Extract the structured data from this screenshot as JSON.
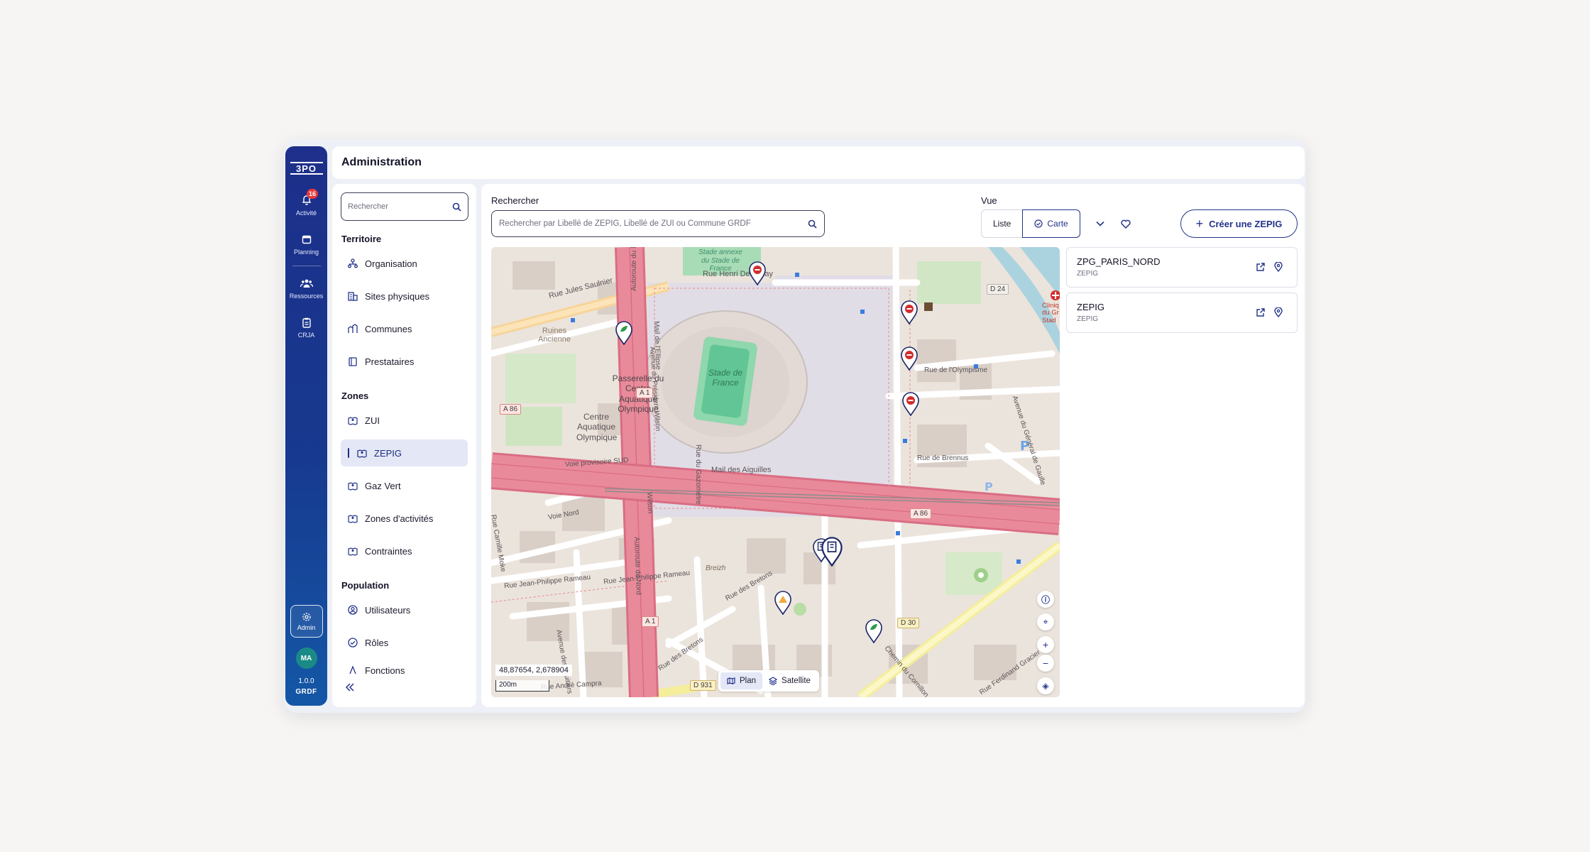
{
  "rail": {
    "logo": "3PO",
    "items": [
      {
        "label": "Activité",
        "icon": "bell-icon",
        "badge": "16"
      },
      {
        "label": "Planning",
        "icon": "calendar-icon"
      },
      {
        "label": "Ressources",
        "icon": "users-icon"
      },
      {
        "label": "CRJA",
        "icon": "clipboard-icon"
      }
    ],
    "admin_label": "Admin",
    "avatar_initials": "MA",
    "version": "1.0.0",
    "brand": "GRDF"
  },
  "header": {
    "title": "Administration"
  },
  "menu": {
    "search_placeholder": "Rechercher",
    "sections": [
      {
        "title": "Territoire",
        "items": [
          {
            "label": "Organisation",
            "icon": "organisation-icon"
          },
          {
            "label": "Sites physiques",
            "icon": "building-icon"
          },
          {
            "label": "Communes",
            "icon": "city-icon"
          },
          {
            "label": "Prestataires",
            "icon": "provider-icon"
          }
        ]
      },
      {
        "title": "Zones",
        "items": [
          {
            "label": "ZUI",
            "icon": "zone-map-icon"
          },
          {
            "label": "ZEPIG",
            "icon": "zone-map-icon",
            "active": true
          },
          {
            "label": "Gaz Vert",
            "icon": "zone-map-icon"
          },
          {
            "label": "Zones d'activités",
            "icon": "zone-map-icon"
          },
          {
            "label": "Contraintes",
            "icon": "zone-map-icon"
          }
        ]
      },
      {
        "title": "Population",
        "items": [
          {
            "label": "Utilisateurs",
            "icon": "user-circle-icon"
          },
          {
            "label": "Rôles",
            "icon": "check-circle-icon"
          },
          {
            "label": "Fonctions",
            "icon": "function-icon"
          }
        ]
      }
    ]
  },
  "main": {
    "search_label": "Rechercher",
    "search_placeholder": "Rechercher par Libellé de ZEPIG, Libellé de ZUI ou Commune GRDF",
    "view_label": "Vue",
    "view_options": {
      "list": "Liste",
      "map": "Carte"
    },
    "create_label": "Créer une ZEPIG"
  },
  "map": {
    "coords": "48,87654,  2,678904",
    "scale": "200m",
    "layers": {
      "plan": "Plan",
      "satellite": "Satellite"
    },
    "labels": {
      "stade": "Stade de France",
      "stade_annexe": "Stade annexe du Stade de France",
      "jules_saulnier": "Rue Jules Saulnier",
      "henri_delaunay": "Rue Henri Delaunay",
      "ruines": "Ruines Ancienne",
      "passerelle": "Passerelle du Centre Aquatique Olympique",
      "centre_aquatique": "Centre Aquatique Olympique",
      "voie_sud": "Voie provisoire SUD",
      "mail_aiguilles": "Mail des Aiguilles",
      "rue_brennus": "Rue de Brennus",
      "rue_olympisme": "Rue de l'Olympisme",
      "voie_nord": "Voie Nord",
      "rameau1": "Rue Jean-Philippe Rameau",
      "rameau2": "Rue Jean-Philippe Rameau",
      "rue_bretons": "Rue des Bretons",
      "rue_bretons2": "Rue des Bretons",
      "rue_gazometre": "Rue du Gazomètre",
      "breizh": "Breizh",
      "autoroute_nord": "Autoroute du Nord",
      "autoroute_nord2": "Autoroute du Nord",
      "ave_fruitiers": "Avenue des Fruitiers",
      "rue_camille": "Rue Camille Moke",
      "ave_campra": "Rue André Campra",
      "chemin_cornillon": "Chemin du Cornillon",
      "rue_ferdinand": "Rue Ferdinand Gracier",
      "ave_general": "Avenue du Général de Gaulle",
      "clinique": "Cliniq du Gr Stad",
      "mail_ellipse": "Mail de l'Ellipse",
      "ave_wilson": "Avenue du Président Wilson",
      "wilson": "Wilson"
    },
    "shields": {
      "a1": "A 1",
      "a1b": "A 1",
      "a86": "A 86",
      "a86b": "A 86",
      "d24": "D 24",
      "d30": "D 30",
      "d931": "D 931"
    }
  },
  "results": [
    {
      "title": "ZPG_PARIS_NORD",
      "subtitle": "ZEPIG"
    },
    {
      "title": "ZEPIG",
      "subtitle": "ZEPIG"
    }
  ],
  "colors": {
    "primary": "#23338a",
    "rail_top": "#1d2f8a",
    "rail_bottom": "#1457a6",
    "badge": "#e5393b",
    "motorway": "#e98a9a"
  }
}
